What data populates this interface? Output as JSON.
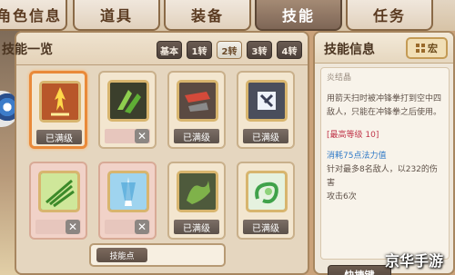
{
  "tabs": [
    {
      "label": "角色信息",
      "active": false
    },
    {
      "label": "道具",
      "active": false
    },
    {
      "label": "装备",
      "active": false
    },
    {
      "label": "技能",
      "active": true
    },
    {
      "label": "任务",
      "active": false
    }
  ],
  "skill_list": {
    "title": "技能一览",
    "filters": [
      {
        "label": "基本",
        "active": false
      },
      {
        "label": "1转",
        "active": false
      },
      {
        "label": "2转",
        "active": true
      },
      {
        "label": "3转",
        "active": false
      },
      {
        "label": "4转",
        "active": false
      }
    ],
    "skills": [
      {
        "icon": "flame-sword-icon",
        "status": "已满级",
        "locked": false,
        "selected": true
      },
      {
        "icon": "green-claw-icon",
        "status": "",
        "locked": true,
        "selected": false
      },
      {
        "icon": "red-fist-icon",
        "status": "已满级",
        "locked": false,
        "selected": false
      },
      {
        "icon": "ghost-punch-icon",
        "status": "已满级",
        "locked": false,
        "selected": false
      },
      {
        "icon": "leaf-fan-icon",
        "status": "",
        "locked": true,
        "selected": false
      },
      {
        "icon": "blue-tornado-icon",
        "status": "",
        "locked": true,
        "selected": false
      },
      {
        "icon": "dragon-claw-icon",
        "status": "已满级",
        "locked": false,
        "selected": false
      },
      {
        "icon": "green-dragon-icon",
        "status": "已满级",
        "locked": false,
        "selected": false
      }
    ],
    "points_label": "技能点"
  },
  "skill_info": {
    "title": "技能信息",
    "macro_label": "宏",
    "skill_name": "炎结晶",
    "description": "用箭天扫时被冲锋拳打到空中四敌人，只能在冲锋拳之后使用。",
    "max_level": "[最高等级 10]",
    "mp_cost": "消耗75点法力值",
    "damage_line_1": "针对最多8名敌人，以232的伤害",
    "damage_line_2": "攻击6次",
    "hotkey_label": "快捷键"
  },
  "watermark": "京华手游",
  "colors": {
    "active_tab": "#7e6656",
    "selected_card_border": "#e98a3a",
    "max_level_text": "#c0364a",
    "mp_text": "#2f79c7"
  }
}
